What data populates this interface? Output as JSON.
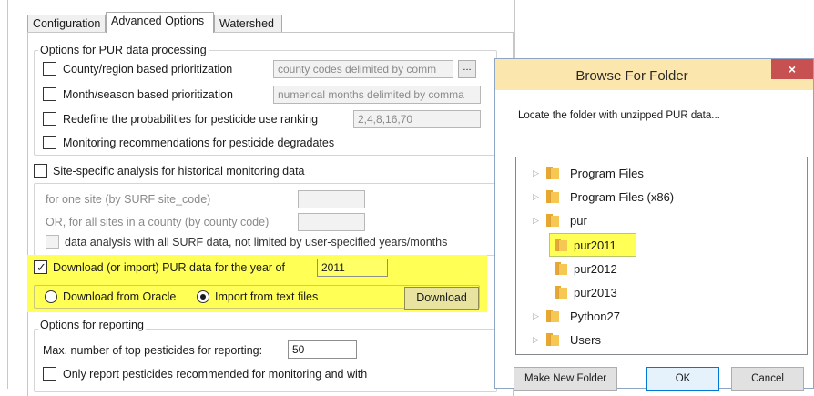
{
  "tabs": [
    {
      "label": "Configuration"
    },
    {
      "label": "Advanced Options"
    },
    {
      "label": "Watershed"
    }
  ],
  "pur_processing": {
    "legend": "Options for PUR data processing",
    "county_label": "County/region based prioritization",
    "county_value": "county codes delimited by comm",
    "browse_label": "...",
    "month_label": "Month/season based prioritization",
    "month_value": "numerical months delimited by comma",
    "redefine_label": "Redefine the probabilities for pesticide use ranking",
    "redefine_value": "2,4,8,16,70",
    "monitoring_label": "Monitoring recommendations for pesticide degradates"
  },
  "site_specific": {
    "label": "Site-specific analysis for historical monitoring data",
    "one_site_label": "for one site (by SURF site_code)",
    "one_site_value": "",
    "county_sites_label": "OR, for all sites in a county (by county code)",
    "county_sites_value": "",
    "all_surf_label": "data analysis with all SURF data, not limited by user-specified years/months"
  },
  "download": {
    "label": "Download (or import) PUR data for the year of",
    "year": "2011",
    "oracle_label": "Download from Oracle",
    "text_files_label": "Import from text files",
    "button_label": "Download",
    "highlight_color": "#ffff55"
  },
  "reporting": {
    "legend": "Options for reporting",
    "max_label": "Max. number of top pesticides for reporting:",
    "max_value": "50",
    "only_report_label": "Only report pesticides recommended for monitoring and with"
  },
  "dialog": {
    "title": "Browse For Folder",
    "close_label": "×",
    "description": "Locate the folder with unzipped PUR data...",
    "title_color": "#fbe7ad",
    "close_color": "#c75050",
    "tree": [
      {
        "label": "Program Files",
        "expandable": true
      },
      {
        "label": "Program Files (x86)",
        "expandable": true
      },
      {
        "label": "pur",
        "expandable": true
      },
      {
        "label": "pur2011",
        "expandable": false,
        "selected": true
      },
      {
        "label": "pur2012",
        "expandable": false
      },
      {
        "label": "pur2013",
        "expandable": false
      },
      {
        "label": "Python27",
        "expandable": true
      },
      {
        "label": "Users",
        "expandable": true
      }
    ],
    "buttons": {
      "new_folder": "Make New Folder",
      "ok": "OK",
      "cancel": "Cancel"
    }
  },
  "icons": {
    "expand": "▷",
    "scroll_up": "^",
    "scroll_down": "v",
    "check": "✓"
  }
}
